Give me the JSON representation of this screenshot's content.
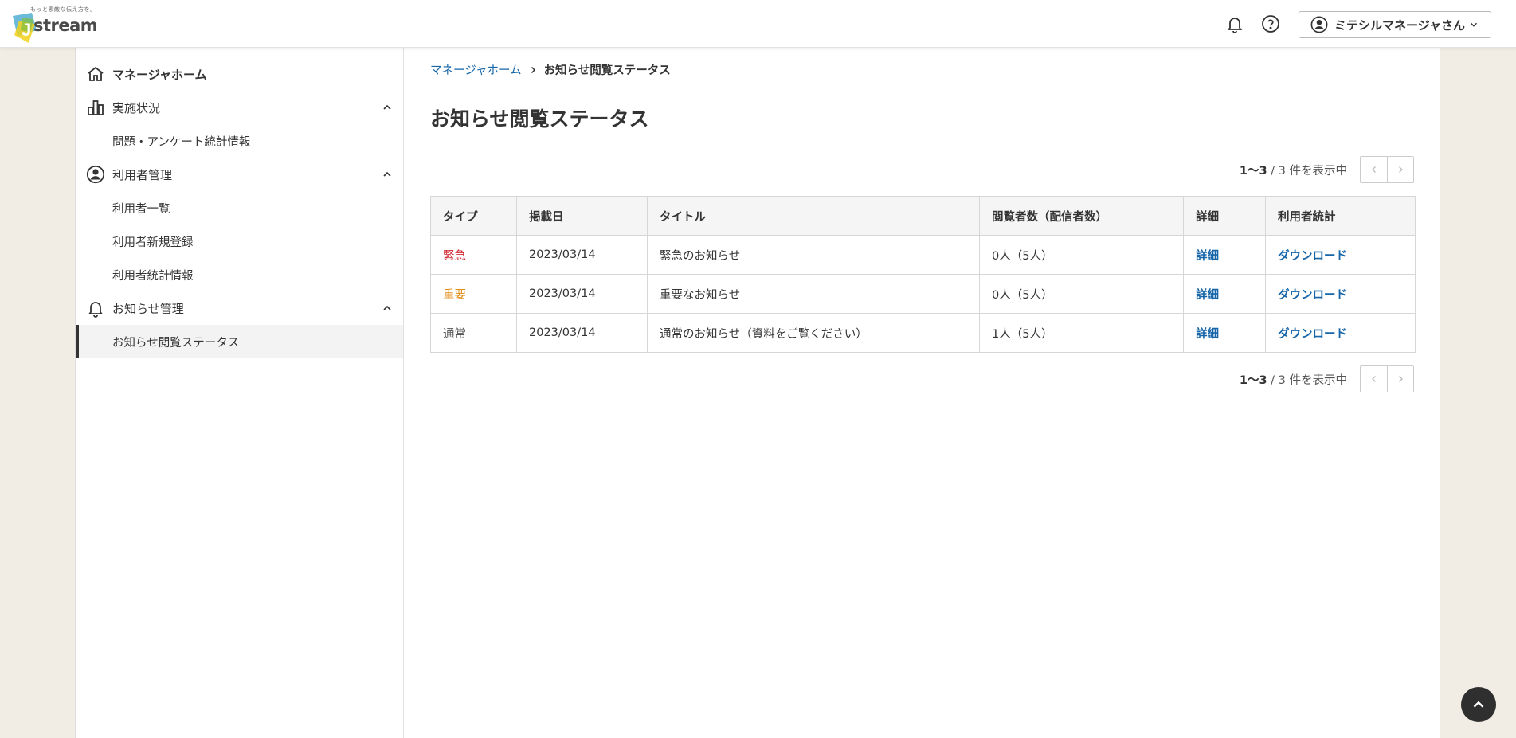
{
  "header": {
    "logo_tagline": "もっと素敵な伝え方を。",
    "logo_text": "stream",
    "user_name": "ミテシルマネージャさん"
  },
  "sidebar": {
    "home": "マネージャホーム",
    "sections": [
      {
        "label": "実施状況",
        "items": [
          "問題・アンケート統計情報"
        ]
      },
      {
        "label": "利用者管理",
        "items": [
          "利用者一覧",
          "利用者新規登録",
          "利用者統計情報"
        ]
      },
      {
        "label": "お知らせ管理",
        "items": [
          "お知らせ閲覧ステータス"
        ]
      }
    ]
  },
  "breadcrumb": {
    "home": "マネージャホーム",
    "current": "お知らせ閲覧ステータス"
  },
  "page_title": "お知らせ閲覧ステータス",
  "pager": {
    "range": "1〜3",
    "rest": " / 3 件を表示中"
  },
  "table": {
    "headers": [
      "タイプ",
      "掲載日",
      "タイトル",
      "閲覧者数（配信者数）",
      "詳細",
      "利用者統計"
    ],
    "rows": [
      {
        "type": "緊急",
        "date": "2023/03/14",
        "title": "緊急のお知らせ",
        "viewers": "0人（5人）",
        "detail": "詳細",
        "stats": "ダウンロード"
      },
      {
        "type": "重要",
        "date": "2023/03/14",
        "title": "重要なお知らせ",
        "viewers": "0人（5人）",
        "detail": "詳細",
        "stats": "ダウンロード"
      },
      {
        "type": "通常",
        "date": "2023/03/14",
        "title": "通常のお知らせ（資料をご覧ください）",
        "viewers": "1人（5人）",
        "detail": "詳細",
        "stats": "ダウンロード"
      }
    ]
  },
  "colors": {
    "urgent": "#d0262e",
    "important": "#e08c14",
    "link": "#1565a8",
    "background": "#f2ede4"
  },
  "icons": [
    "bell-icon",
    "help-icon",
    "user-circle-icon",
    "chevron-down-icon",
    "home-icon",
    "chart-icon",
    "chevron-up-icon",
    "chevron-right-icon",
    "chevron-left-icon",
    "arrow-up-icon"
  ]
}
